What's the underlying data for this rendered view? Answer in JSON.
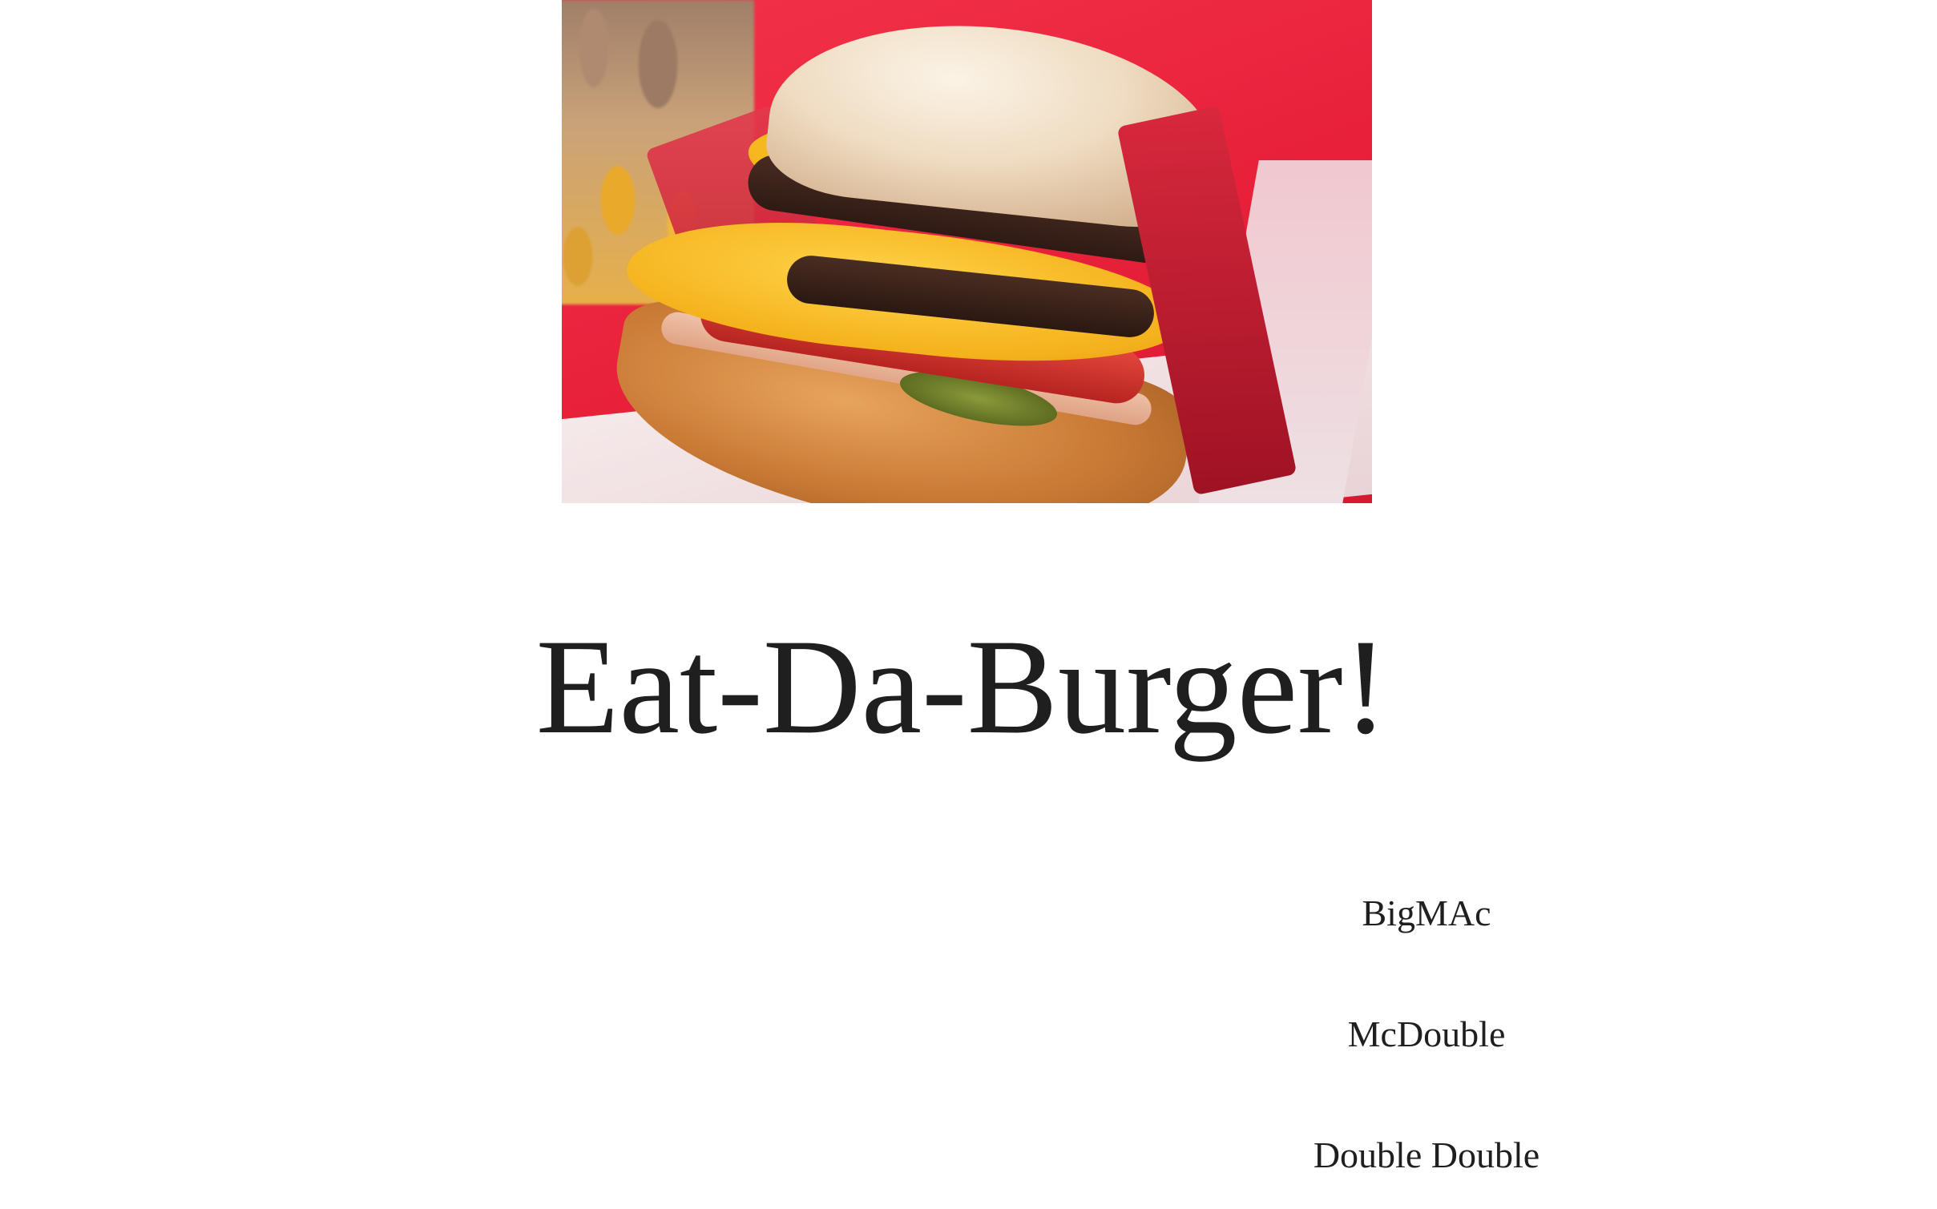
{
  "hero": {
    "image_alt": "burger-photo"
  },
  "page": {
    "title": "Eat-Da-Burger!"
  },
  "burgers": [
    {
      "name": "BigMAc"
    },
    {
      "name": "McDouble"
    },
    {
      "name": "Double Double"
    }
  ],
  "colors": {
    "background": "#ffffff",
    "text": "#1f1f1f",
    "tray_red": "#e8203a",
    "cheese_yellow": "#f6b71f"
  }
}
